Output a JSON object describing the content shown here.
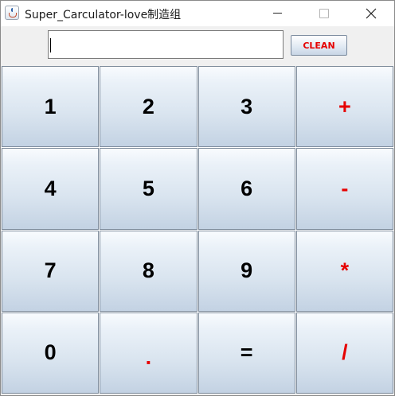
{
  "window": {
    "title": "Super_Carculator-love制造组",
    "app_icon": "java-cup-icon",
    "controls": [
      "minimize-icon",
      "maximize-icon",
      "close-icon"
    ]
  },
  "display": {
    "value": "",
    "placeholder": ""
  },
  "clean_button": {
    "label": "CLEAN",
    "color": "#e60000"
  },
  "colors": {
    "operator": "#e60000",
    "digit": "#000000",
    "key_border": "#7d8b9b"
  },
  "keys": [
    {
      "label": "1",
      "kind": "digit"
    },
    {
      "label": "2",
      "kind": "digit"
    },
    {
      "label": "3",
      "kind": "digit"
    },
    {
      "label": "+",
      "kind": "operator"
    },
    {
      "label": "4",
      "kind": "digit"
    },
    {
      "label": "5",
      "kind": "digit"
    },
    {
      "label": "6",
      "kind": "digit"
    },
    {
      "label": "-",
      "kind": "operator"
    },
    {
      "label": "7",
      "kind": "digit"
    },
    {
      "label": "8",
      "kind": "digit"
    },
    {
      "label": "9",
      "kind": "digit"
    },
    {
      "label": "*",
      "kind": "operator"
    },
    {
      "label": "0",
      "kind": "digit"
    },
    {
      "label": ".",
      "kind": "operator"
    },
    {
      "label": "=",
      "kind": "digit"
    },
    {
      "label": "/",
      "kind": "operator"
    }
  ]
}
